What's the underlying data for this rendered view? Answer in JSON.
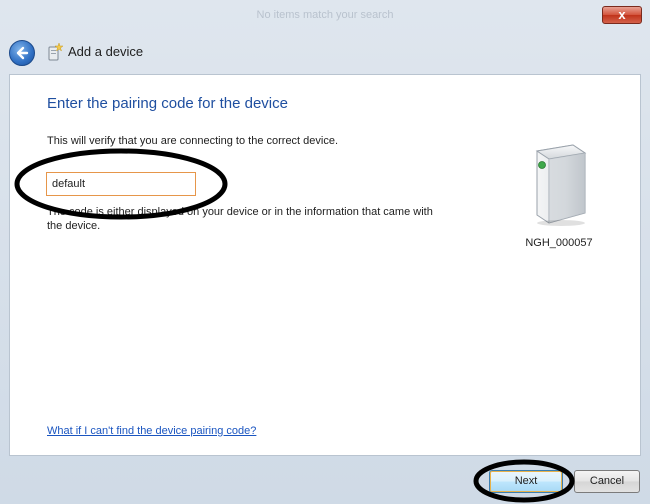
{
  "window": {
    "title": "No items match your search",
    "close_label": "x"
  },
  "nav": {
    "title": "Add a device",
    "back_icon": "back-arrow-icon",
    "device_icon": "device-add-icon"
  },
  "content": {
    "heading": "Enter the pairing code for the device",
    "description": "This will verify that you are connecting to the correct device.",
    "input_value": "default",
    "hint": "The code is either displayed on your device or in the information that came with the device.",
    "device_name": "NGH_000057",
    "help_link": "What if I can't find the device pairing code?"
  },
  "buttons": {
    "next": "Next",
    "cancel": "Cancel"
  },
  "colors": {
    "heading": "#1f4fa0",
    "link": "#1a55c0",
    "input_border": "#e6964a",
    "annotation": "#000000"
  }
}
